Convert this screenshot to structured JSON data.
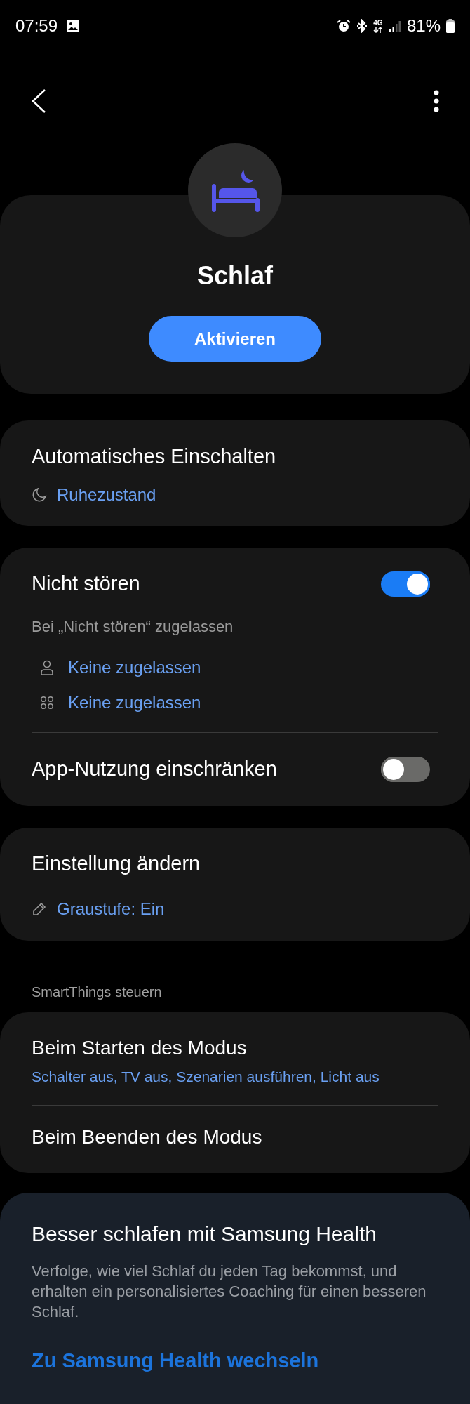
{
  "status_bar": {
    "time": "07:59",
    "network": "4G",
    "battery": "81%"
  },
  "mode": {
    "title": "Schlaf",
    "button": "Aktivieren"
  },
  "auto_on": {
    "title": "Automatisches Einschalten",
    "value": "Ruhezustand"
  },
  "dnd": {
    "title": "Nicht stören",
    "on": true,
    "caption": "Bei „Nicht stören“ zugelassen",
    "allowed": [
      {
        "kind": "people",
        "label": "Keine zugelassen"
      },
      {
        "kind": "apps",
        "label": "Keine zugelassen"
      }
    ]
  },
  "app_usage": {
    "title": "App-Nutzung einschränken",
    "on": false
  },
  "settings_change": {
    "title": "Einstellung ändern",
    "value": "Graustufe: Ein"
  },
  "smartthings": {
    "header": "SmartThings steuern",
    "items": [
      {
        "title": "Beim Starten des Modus",
        "detail": "Schalter aus, TV aus, Szenarien ausführen, Licht aus"
      },
      {
        "title": "Beim Beenden des Modus"
      }
    ]
  },
  "promo": {
    "title": "Besser schlafen mit Samsung Health",
    "body": "Verfolge, wie viel Schlaf du jeden Tag bekommst, und erhalten ein personalisiertes Coaching für einen besseren Schlaf.",
    "link": "Zu Samsung Health wechseln"
  }
}
